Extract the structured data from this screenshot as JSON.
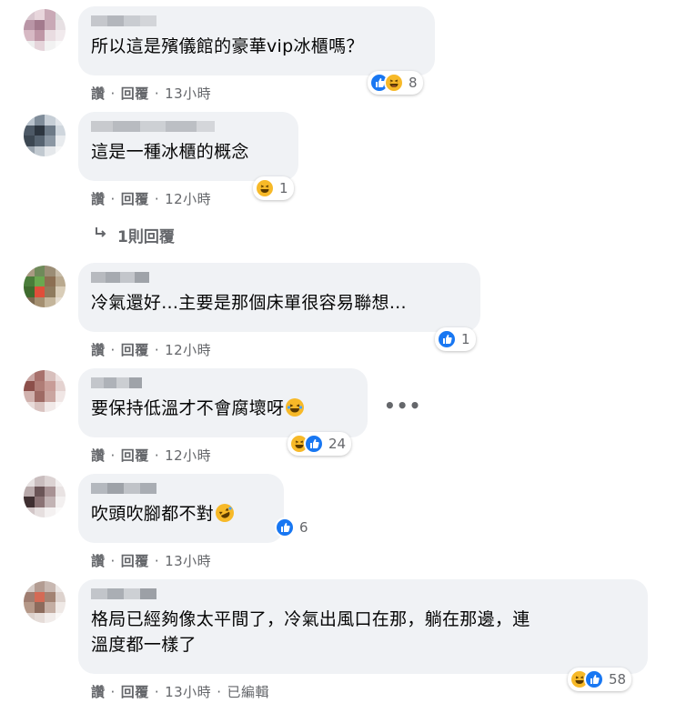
{
  "comments": [
    {
      "text": "所以這是殯儀館的豪華vip冰櫃嗎？",
      "actions": {
        "like": "讚",
        "reply": "回覆",
        "time": "13小時",
        "edited": ""
      },
      "reactions": {
        "icons": [
          "like-icon",
          "haha-icon"
        ],
        "count": "8"
      }
    },
    {
      "text": "這是一種冰櫃的概念",
      "actions": {
        "like": "讚",
        "reply": "回覆",
        "time": "12小時",
        "edited": ""
      },
      "reactions": {
        "icons": [
          "haha-icon"
        ],
        "count": "1"
      }
    },
    {
      "text": "冷氣還好...主要是那個床單很容易聯想...",
      "actions": {
        "like": "讚",
        "reply": "回覆",
        "time": "12小時",
        "edited": ""
      },
      "reactions": {
        "icons": [
          "like-icon"
        ],
        "count": "1"
      }
    },
    {
      "text": "要保持低溫才不會腐壞呀",
      "actions": {
        "like": "讚",
        "reply": "回覆",
        "time": "12小時",
        "edited": ""
      },
      "reactions": {
        "icons": [
          "haha-icon",
          "like-icon"
        ],
        "count": "24"
      }
    },
    {
      "text": "吹頭吹腳都不對",
      "actions": {
        "like": "讚",
        "reply": "回覆",
        "time": "13小時",
        "edited": ""
      },
      "reactions": {
        "icons": [
          "like-icon"
        ],
        "count": "6"
      }
    },
    {
      "text_line1": "格局已經夠像太平間了，冷氣出風口在那，躺在那邊，連",
      "text_line2": "溫度都一樣了",
      "actions": {
        "like": "讚",
        "reply": "回覆",
        "time": "13小時",
        "edited": "已編輯"
      },
      "reactions": {
        "icons": [
          "haha-icon",
          "like-icon"
        ],
        "count": "58"
      }
    }
  ],
  "reply_link": {
    "label": "1則回覆",
    "icon": "reply-arrow-icon"
  },
  "more_menu": {
    "label": "•••"
  },
  "colors": {
    "bubble_bg": "#f0f2f5",
    "meta_text": "#65676b",
    "like_blue": "#1877f2",
    "haha_yellow": "#f7b928"
  }
}
